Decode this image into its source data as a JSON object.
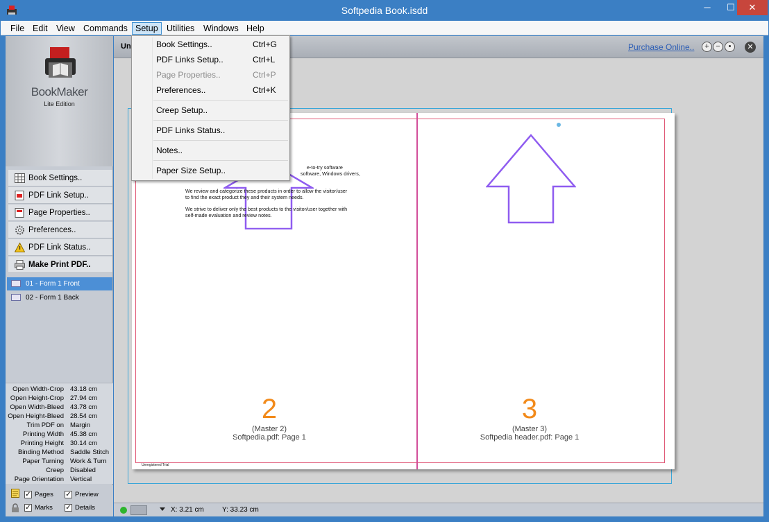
{
  "window": {
    "title": "Softpedia Book.isdd",
    "minimize": "─",
    "maximize": "☐",
    "close": "✕"
  },
  "menubar": [
    "File",
    "Edit",
    "View",
    "Commands",
    "Setup",
    "Utilities",
    "Windows",
    "Help"
  ],
  "setup_menu": [
    {
      "label": "Book Settings..",
      "shortcut": "Ctrl+G",
      "disabled": false
    },
    {
      "label": "PDF Links Setup..",
      "shortcut": "Ctrl+L",
      "disabled": false
    },
    {
      "label": "Page Properties..",
      "shortcut": "Ctrl+P",
      "disabled": true
    },
    {
      "label": "Preferences..",
      "shortcut": "Ctrl+K",
      "disabled": false
    },
    {
      "label": "Creep Setup..",
      "shortcut": "",
      "disabled": false
    },
    {
      "label": "PDF Links Status..",
      "shortcut": "",
      "disabled": false
    },
    {
      "label": "Notes..",
      "shortcut": "",
      "disabled": false
    },
    {
      "label": "Paper Size Setup..",
      "shortcut": "",
      "disabled": false
    }
  ],
  "sidebar": {
    "logo_title": "BookMaker",
    "logo_subtitle": "Lite Edition",
    "buttons": [
      {
        "label": "Book Settings..",
        "icon": "grid-icon",
        "bold": false
      },
      {
        "label": "PDF Link Setup..",
        "icon": "pdf-icon",
        "bold": false
      },
      {
        "label": "Page Properties..",
        "icon": "page-icon",
        "bold": false
      },
      {
        "label": "Preferences..",
        "icon": "gear-icon",
        "bold": false
      },
      {
        "label": "PDF Link Status..",
        "icon": "warning-icon",
        "bold": false
      },
      {
        "label": "Make Print PDF..",
        "icon": "printer-icon",
        "bold": true
      }
    ],
    "pages": [
      {
        "label": "01 - Form 1 Front",
        "selected": true
      },
      {
        "label": "02 - Form 1 Back",
        "selected": false
      }
    ],
    "info": [
      {
        "key": "Open Width-Crop",
        "value": "43.18 cm"
      },
      {
        "key": "Open Height-Crop",
        "value": "27.94 cm"
      },
      {
        "key": "Open Width-Bleed",
        "value": "43.78 cm"
      },
      {
        "key": "Open Height-Bleed",
        "value": "28.54 cm"
      },
      {
        "key": "Trim PDF on",
        "value": "Margin"
      },
      {
        "key": "Printing Width",
        "value": "45.38 cm"
      },
      {
        "key": "Printing Height",
        "value": "30.14 cm"
      },
      {
        "key": "Binding Method",
        "value": "Saddle Stitch"
      },
      {
        "key": "Paper Turning",
        "value": "Work & Turn"
      },
      {
        "key": "Creep",
        "value": "Disabled"
      },
      {
        "key": "Page Orientation",
        "value": "Vertical"
      }
    ],
    "checks": {
      "pages": "Pages",
      "preview": "Preview",
      "marks": "Marks",
      "details": "Details"
    }
  },
  "workspace": {
    "doc_label": "Un",
    "purchase_link": "Purchase Online..",
    "left_page": {
      "number": "2",
      "master": "(Master 2)",
      "source": "Softpedia.pdf: Page 1",
      "text_1a": "e-to-try software",
      "text_1b": "software, Windows drivers,",
      "text_2a": "We review and categorize these products in order to allow the visitor/user",
      "text_2b": "to find the exact product they and their system needs.",
      "text_3a": "We strive to deliver only the best products to the visitor/user together with",
      "text_3b": "self-made evaluation and review notes.",
      "footer": "Unregistered Trial"
    },
    "right_page": {
      "number": "3",
      "master": "(Master 3)",
      "source": "Softpedia header.pdf: Page 1"
    }
  },
  "statusbar": {
    "x": "X: 3.21 cm",
    "y": "Y: 33.23 cm"
  },
  "colors": {
    "accent": "#3b7fc4",
    "page_number": "#f28a1a",
    "arrow": "#8f5cf0",
    "fold": "#d24e9a"
  }
}
